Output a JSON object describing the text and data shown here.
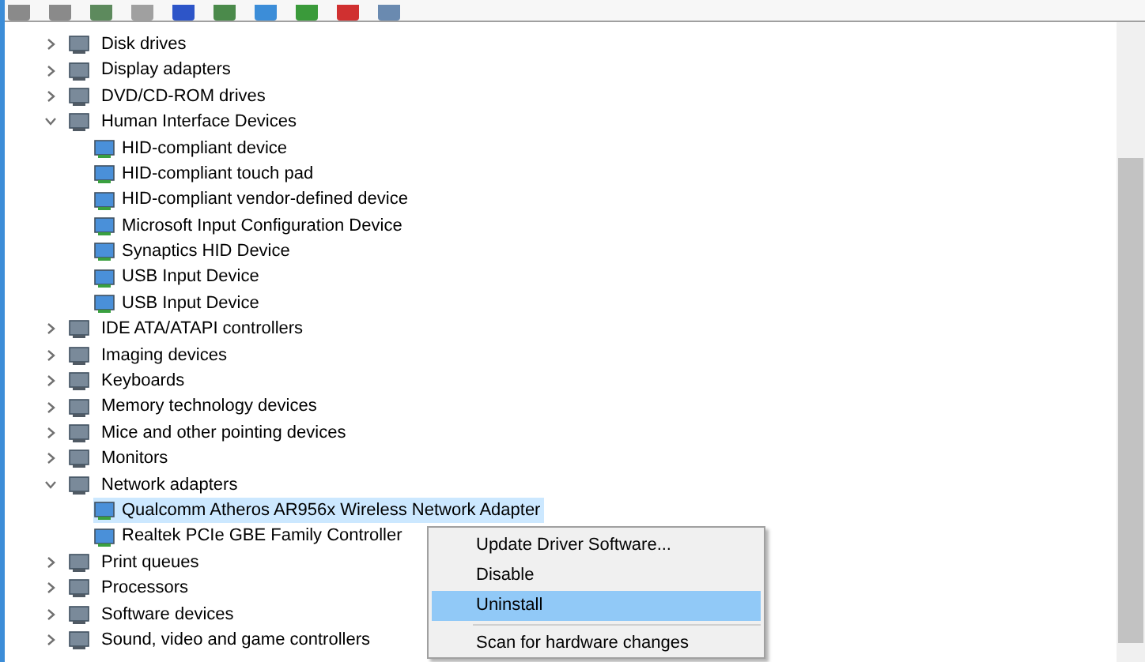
{
  "tree": [
    {
      "label": "Disk drives",
      "expanded": false
    },
    {
      "label": "Display adapters",
      "expanded": false
    },
    {
      "label": "DVD/CD-ROM drives",
      "expanded": false
    },
    {
      "label": "Human Interface Devices",
      "expanded": true,
      "children": [
        {
          "label": "HID-compliant device",
          "selected": false
        },
        {
          "label": "HID-compliant touch pad",
          "selected": false
        },
        {
          "label": "HID-compliant vendor-defined device",
          "selected": false
        },
        {
          "label": "Microsoft Input Configuration Device",
          "selected": false
        },
        {
          "label": "Synaptics HID Device",
          "selected": false
        },
        {
          "label": "USB Input Device",
          "selected": false
        },
        {
          "label": "USB Input Device",
          "selected": false
        }
      ]
    },
    {
      "label": "IDE ATA/ATAPI controllers",
      "expanded": false
    },
    {
      "label": "Imaging devices",
      "expanded": false
    },
    {
      "label": "Keyboards",
      "expanded": false
    },
    {
      "label": "Memory technology devices",
      "expanded": false
    },
    {
      "label": "Mice and other pointing devices",
      "expanded": false
    },
    {
      "label": "Monitors",
      "expanded": false
    },
    {
      "label": "Network adapters",
      "expanded": true,
      "children": [
        {
          "label": "Qualcomm Atheros AR956x Wireless Network Adapter",
          "selected": true
        },
        {
          "label": "Realtek PCIe GBE Family Controller",
          "selected": false
        }
      ]
    },
    {
      "label": "Print queues",
      "expanded": false
    },
    {
      "label": "Processors",
      "expanded": false
    },
    {
      "label": "Software devices",
      "expanded": false
    },
    {
      "label": "Sound, video and game controllers",
      "expanded": false
    }
  ],
  "context_menu": [
    {
      "kind": "item",
      "label": "Update Driver Software...",
      "selected": false
    },
    {
      "kind": "item",
      "label": "Disable",
      "selected": false
    },
    {
      "kind": "item",
      "label": "Uninstall",
      "selected": true
    },
    {
      "kind": "separator"
    },
    {
      "kind": "item",
      "label": "Scan for hardware changes",
      "selected": false
    }
  ]
}
